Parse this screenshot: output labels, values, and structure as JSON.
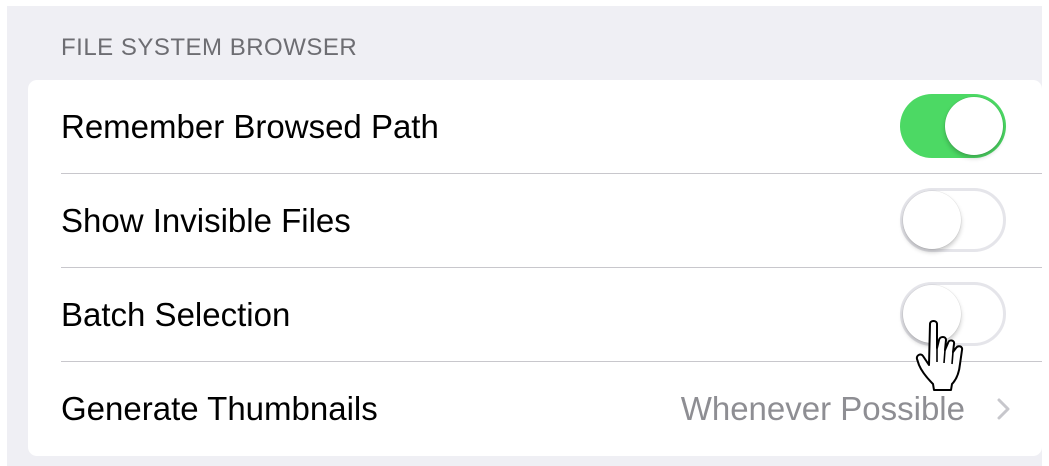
{
  "section": {
    "title": "FILE SYSTEM BROWSER"
  },
  "rows": [
    {
      "label": "Remember Browsed Path",
      "control": "toggle",
      "state": "on"
    },
    {
      "label": "Show Invisible Files",
      "control": "toggle",
      "state": "off"
    },
    {
      "label": "Batch Selection",
      "control": "toggle",
      "state": "off"
    },
    {
      "label": "Generate Thumbnails",
      "control": "disclosure",
      "value": "Whenever Possible"
    }
  ],
  "colors": {
    "toggle_on": "#4cd964",
    "background": "#efeff4",
    "secondary_text": "#8e8e93"
  },
  "icons": {
    "disclosure": "chevron-right-icon",
    "pointer": "hand-pointer-icon"
  }
}
